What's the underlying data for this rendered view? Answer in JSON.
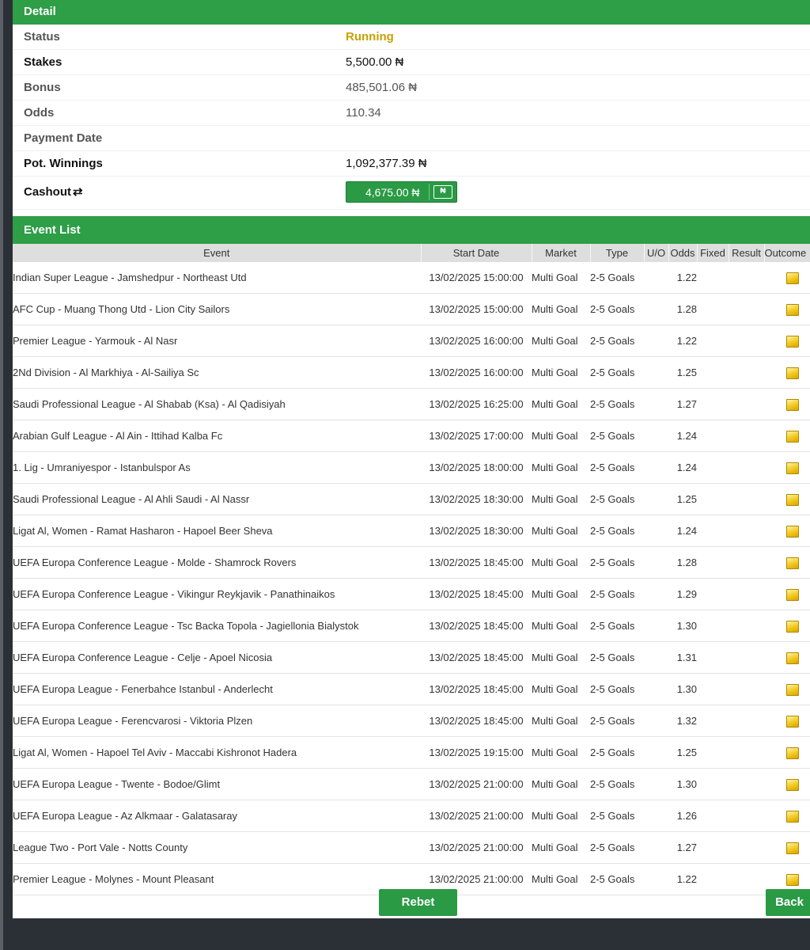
{
  "detail": {
    "title": "Detail",
    "rows": [
      {
        "label": "Status",
        "value": "Running"
      },
      {
        "label": "Stakes",
        "value": "5,500.00 ₦"
      },
      {
        "label": "Bonus",
        "value": "485,501.06 ₦"
      },
      {
        "label": "Odds",
        "value": "110.34"
      },
      {
        "label": "Payment Date",
        "value": ""
      },
      {
        "label": "Pot. Winnings",
        "value": "1,092,377.39 ₦"
      }
    ],
    "cashout_label": "Cashout",
    "cashout_amount": "4,675.00 ₦",
    "cashout_icon_text": "₦"
  },
  "events": {
    "title": "Event List",
    "columns": [
      "Event",
      "Start Date",
      "Market",
      "Type",
      "U/O",
      "Odds",
      "Fixed",
      "Result",
      "Outcome"
    ],
    "rows": [
      {
        "event": "Indian Super League - Jamshedpur - Northeast Utd",
        "date": "13/02/2025 15:00:00",
        "market": "Multi Goal",
        "type": "2-5 Goals",
        "odds": "1.22"
      },
      {
        "event": "AFC Cup - Muang Thong Utd - Lion City Sailors",
        "date": "13/02/2025 15:00:00",
        "market": "Multi Goal",
        "type": "2-5 Goals",
        "odds": "1.28"
      },
      {
        "event": "Premier League - Yarmouk - Al Nasr",
        "date": "13/02/2025 16:00:00",
        "market": "Multi Goal",
        "type": "2-5 Goals",
        "odds": "1.22"
      },
      {
        "event": "2Nd Division - Al Markhiya - Al-Sailiya Sc",
        "date": "13/02/2025 16:00:00",
        "market": "Multi Goal",
        "type": "2-5 Goals",
        "odds": "1.25"
      },
      {
        "event": "Saudi Professional League - Al Shabab (Ksa) - Al Qadisiyah",
        "date": "13/02/2025 16:25:00",
        "market": "Multi Goal",
        "type": "2-5 Goals",
        "odds": "1.27"
      },
      {
        "event": "Arabian Gulf League - Al Ain - Ittihad Kalba Fc",
        "date": "13/02/2025 17:00:00",
        "market": "Multi Goal",
        "type": "2-5 Goals",
        "odds": "1.24"
      },
      {
        "event": "1. Lig - Umraniyespor - Istanbulspor As",
        "date": "13/02/2025 18:00:00",
        "market": "Multi Goal",
        "type": "2-5 Goals",
        "odds": "1.24"
      },
      {
        "event": "Saudi Professional League - Al Ahli Saudi - Al Nassr",
        "date": "13/02/2025 18:30:00",
        "market": "Multi Goal",
        "type": "2-5 Goals",
        "odds": "1.25"
      },
      {
        "event": "Ligat Al, Women - Ramat Hasharon - Hapoel Beer Sheva",
        "date": "13/02/2025 18:30:00",
        "market": "Multi Goal",
        "type": "2-5 Goals",
        "odds": "1.24"
      },
      {
        "event": "UEFA Europa Conference League - Molde - Shamrock Rovers",
        "date": "13/02/2025 18:45:00",
        "market": "Multi Goal",
        "type": "2-5 Goals",
        "odds": "1.28"
      },
      {
        "event": "UEFA Europa Conference League - Vikingur Reykjavik - Panathinaikos",
        "date": "13/02/2025 18:45:00",
        "market": "Multi Goal",
        "type": "2-5 Goals",
        "odds": "1.29"
      },
      {
        "event": "UEFA Europa Conference League - Tsc Backa Topola - Jagiellonia Bialystok",
        "date": "13/02/2025 18:45:00",
        "market": "Multi Goal",
        "type": "2-5 Goals",
        "odds": "1.30"
      },
      {
        "event": "UEFA Europa Conference League - Celje - Apoel Nicosia",
        "date": "13/02/2025 18:45:00",
        "market": "Multi Goal",
        "type": "2-5 Goals",
        "odds": "1.31"
      },
      {
        "event": "UEFA Europa League - Fenerbahce Istanbul - Anderlecht",
        "date": "13/02/2025 18:45:00",
        "market": "Multi Goal",
        "type": "2-5 Goals",
        "odds": "1.30"
      },
      {
        "event": "UEFA Europa League - Ferencvarosi - Viktoria Plzen",
        "date": "13/02/2025 18:45:00",
        "market": "Multi Goal",
        "type": "2-5 Goals",
        "odds": "1.32"
      },
      {
        "event": "Ligat Al, Women - Hapoel Tel Aviv - Maccabi Kishronot Hadera",
        "date": "13/02/2025 19:15:00",
        "market": "Multi Goal",
        "type": "2-5 Goals",
        "odds": "1.25"
      },
      {
        "event": "UEFA Europa League - Twente - Bodoe/Glimt",
        "date": "13/02/2025 21:00:00",
        "market": "Multi Goal",
        "type": "2-5 Goals",
        "odds": "1.30"
      },
      {
        "event": "UEFA Europa League - Az Alkmaar - Galatasaray",
        "date": "13/02/2025 21:00:00",
        "market": "Multi Goal",
        "type": "2-5 Goals",
        "odds": "1.26"
      },
      {
        "event": "League Two - Port Vale - Notts County",
        "date": "13/02/2025 21:00:00",
        "market": "Multi Goal",
        "type": "2-5 Goals",
        "odds": "1.27"
      },
      {
        "event": "Premier League - Molynes - Mount Pleasant",
        "date": "13/02/2025 21:00:00",
        "market": "Multi Goal",
        "type": "2-5 Goals",
        "odds": "1.22"
      }
    ]
  },
  "buttons": {
    "rebet": "Rebet",
    "back": "Back"
  },
  "colors": {
    "header_green": "#2e9e47",
    "status_running": "#c9a000",
    "button_green": "#2a9a45"
  }
}
